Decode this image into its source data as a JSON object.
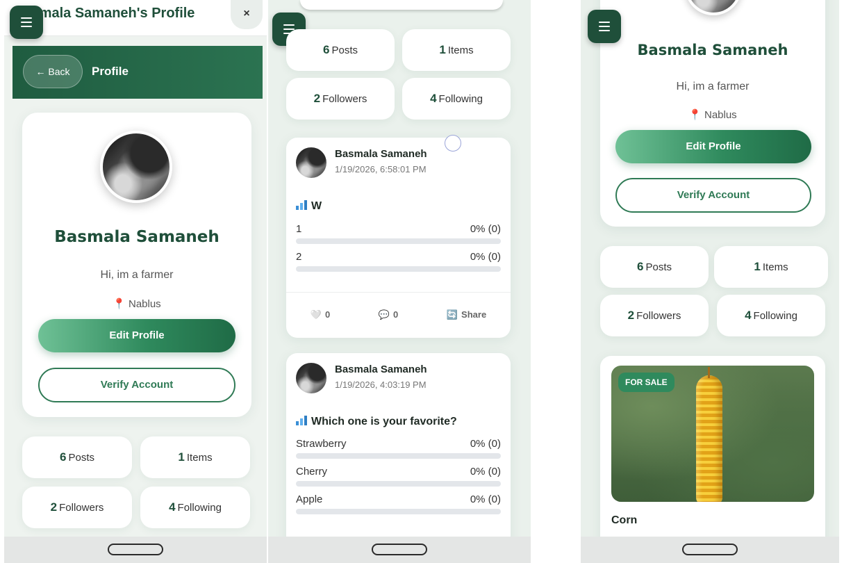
{
  "profile": {
    "name": "Basmala Samaneh",
    "bio": "Hi, im a farmer",
    "location": "Nablus",
    "header_title": "Basmala Samaneh's Profile",
    "back_label": "← Back",
    "page_label": "Profile",
    "close_label": "×",
    "edit_label": "Edit Profile",
    "verify_label": "Verify Account"
  },
  "stats": {
    "posts_count": "6",
    "posts_label": "Posts",
    "items_count": "1",
    "items_label": "Items",
    "followers_count": "2",
    "followers_label": "Followers",
    "following_count": "4",
    "following_label": "Following"
  },
  "posts": [
    {
      "author": "Basmala Samaneh",
      "date": "1/19/2026, 6:58:01 PM",
      "question": "W",
      "options": [
        {
          "label": "1",
          "result": "0% (0)",
          "fraction": 0
        },
        {
          "label": "2",
          "result": "0% (0)",
          "fraction": 0
        }
      ],
      "likes": "0",
      "comments": "0",
      "share_label": "Share"
    },
    {
      "author": "Basmala Samaneh",
      "date": "1/19/2026, 4:03:19 PM",
      "question": "Which one is your favorite?",
      "options": [
        {
          "label": "Strawberry",
          "result": "0% (0)",
          "fraction": 0
        },
        {
          "label": "Cherry",
          "result": "0% (0)",
          "fraction": 0
        },
        {
          "label": "Apple",
          "result": "0% (0)",
          "fraction": 0
        }
      ]
    }
  ],
  "item": {
    "tag": "FOR SALE",
    "title": "Corn"
  },
  "icons": {
    "menu": "hamburger-menu-icon",
    "location": "map-pin-icon",
    "poll": "bar-chart-icon",
    "like": "heart-icon",
    "comment": "comment-icon",
    "share": "share-icon"
  },
  "colors": {
    "brand_dark": "#1f4f3a",
    "brand": "#2f8a5d",
    "brand_light": "#6fc196"
  }
}
